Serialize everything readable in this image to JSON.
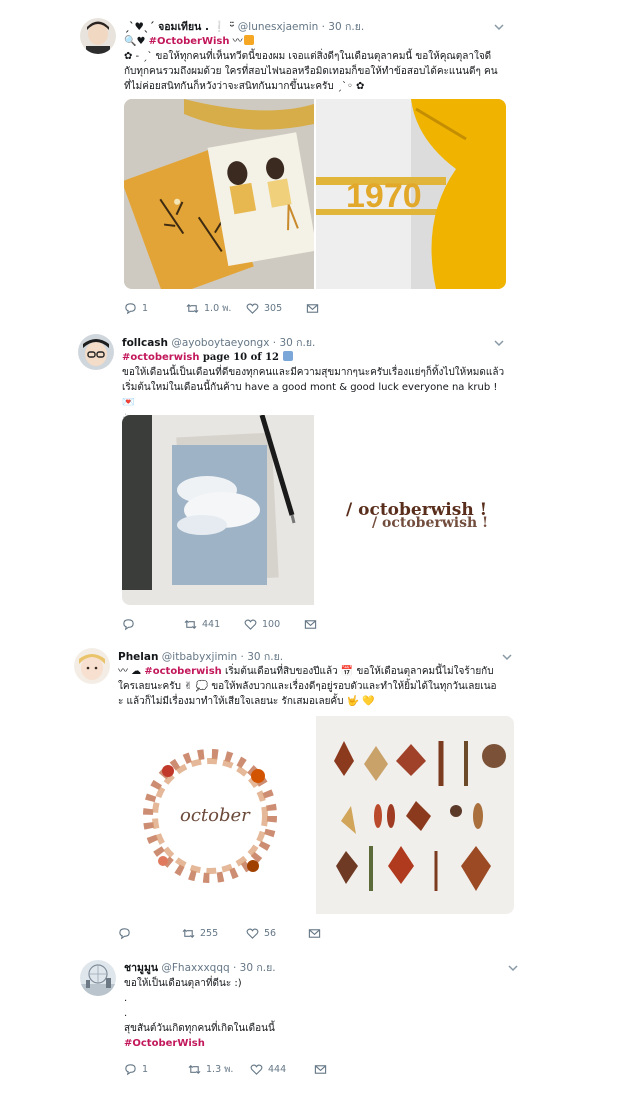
{
  "tweets": [
    {
      "name": "ˏˋ♥ˎˊ จอมเทียน . ❕ ᵕ̈",
      "handle": "@lunesxjaemin",
      "date": "· 30 ก.ย.",
      "tag_line_tag": "#OctoberWish",
      "text_lines": [
        "✿ - ˏˋ ขอให้ทุกคนที่เห็นทวีตนี้ของผม เจอแต่สิ่งดีๆในเดือนตุลาคมนี้ ขอให้คุณตุลาใจดี",
        "กับทุกคนรวมถึงผมด้วย ใครที่สอบไฟนอลหรือมิดเทอมก็ขอให้ทำข้อสอบได้คะแนนดีๆ คน",
        "ที่ไม่ค่อยสนิทกันก็หวังว่าจะสนิทกันมากขึ้นนะครับ ˏˋ◦ ✿"
      ],
      "reply_count": "1",
      "retweet_count": "1.0 พ.",
      "like_count": "305",
      "image_numbers": "1970"
    },
    {
      "name": "follcash",
      "handle": "@ayoboytaeyongx",
      "date": "· 30 ก.ย.",
      "tag": "#octoberwish",
      "page_text": " page 10 of 12",
      "text_lines": [
        "ขอให้เดือนนี้เป็นเดือนที่ดีของทุกคนและมีความสุขมากๆนะครับเรื่องแย่ๆก็ทิ้งไปให้หมดแล้ว",
        "เริ่มต้นใหม่ในเดือนนี้กันค้าบ have a good mont & good luck everyone na krub ! 💌",
        "☕"
      ],
      "reply_count": "",
      "retweet_count": "441",
      "like_count": "100",
      "image_caption": "/ octoberwish !"
    },
    {
      "name": "Phelan",
      "handle": "@itbabyxjimin",
      "date": "· 30 ก.ย.",
      "tag": "#octoberwish",
      "line1_prefix": "〰 ☁ ",
      "line1_suffix": " เริ่มต้นเดือนที่สิบของปีแล้ว 📅 ขอให้เดือนตุลาคมนี้ไม่ใจร้ายกับ",
      "text_lines": [
        "ใครเลยนะครับ ✌ 💭 ขอให้พลังบวกและเรื่องดีๆอยู่รอบตัวและทำให้ยิ้มได้ในทุกวันเลยเนอ",
        "ะ แล้วก็ไม่มีเรื่องมาทำให้เสียใจเลยนะ รักเสมอเลยคั้บ 🤟 💛"
      ],
      "reply_count": "",
      "retweet_count": "255",
      "like_count": "56",
      "image_wreath_text": "october"
    },
    {
      "name": "ชามูมูน",
      "handle": "@Fhaxxxqqq",
      "date": "· 30 ก.ย.",
      "text_lines": [
        "ขอให้เป็นเดือนตุลาที่ดีนะ :)",
        ".",
        ".",
        "สุขสันต์วันเกิดทุกคนที่เกิดในเดือนนี้"
      ],
      "tag": "#OctoberWish",
      "reply_count": "1",
      "retweet_count": "1.3 พ.",
      "like_count": "444"
    }
  ]
}
